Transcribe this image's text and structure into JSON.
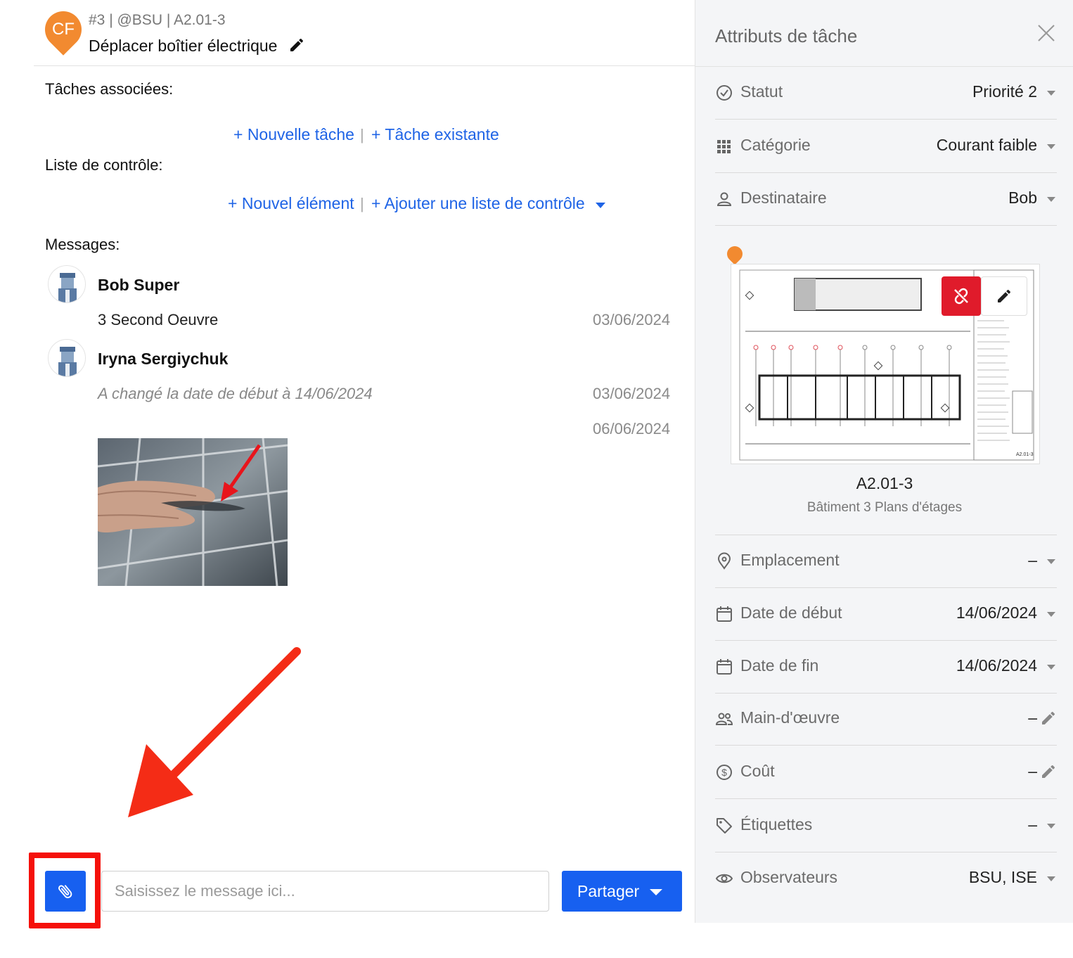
{
  "task": {
    "pin_initials": "CF",
    "meta": "#3 | @BSU | A2.01-3",
    "title": "Déplacer boîtier électrique",
    "pin_color": "#f28a30"
  },
  "associated": {
    "label": "Tâches associées:",
    "new_task": "+ Nouvelle tâche",
    "separator": "|",
    "existing_task": "+ Tâche existante"
  },
  "checklist": {
    "label": "Liste de contrôle:",
    "new_item": "+ Nouvel élément",
    "separator": "|",
    "add_list": "+ Ajouter une liste de contrôle"
  },
  "messages": {
    "label": "Messages:",
    "items": [
      {
        "author": "Bob Super",
        "text": "3 Second Oeuvre",
        "date": "03/06/2024"
      },
      {
        "author": "Iryna Sergiychuk",
        "text": "A changé la date de début à 14/06/2024",
        "date": "03/06/2024"
      },
      {
        "date": "06/06/2024"
      }
    ]
  },
  "composer": {
    "placeholder": "Saisissez le message ici...",
    "share_label": "Partager",
    "attach_icon": "paperclip-icon",
    "accent": "#1760f0",
    "highlight_color": "#f5100a"
  },
  "sidebar": {
    "title": "Attributs de tâche",
    "attributes": [
      {
        "label": "Statut",
        "value": "Priorité 2",
        "icon": "check-circle-icon"
      },
      {
        "label": "Catégorie",
        "value": "Courant faible",
        "icon": "grid-icon"
      },
      {
        "label": "Destinataire",
        "value": "Bob",
        "icon": "person-icon"
      },
      {
        "label": "Emplacement",
        "value": "–",
        "icon": "location-pin-icon"
      },
      {
        "label": "Date de début",
        "value": "14/06/2024",
        "icon": "calendar-icon"
      },
      {
        "label": "Date de fin",
        "value": "14/06/2024",
        "icon": "calendar-icon"
      },
      {
        "label": "Main-d'œuvre",
        "value": "–",
        "icon": "people-icon"
      },
      {
        "label": "Coût",
        "value": "–",
        "icon": "dollar-circle-icon"
      },
      {
        "label": "Étiquettes",
        "value": "–",
        "icon": "tag-icon"
      },
      {
        "label": "Observateurs",
        "value": "BSU, ISE",
        "icon": "eye-icon"
      }
    ],
    "plan": {
      "name": "A2.01-3",
      "subtitle": "Bâtiment 3 Plans d'étages",
      "unlink_color": "#e01b2b"
    }
  }
}
